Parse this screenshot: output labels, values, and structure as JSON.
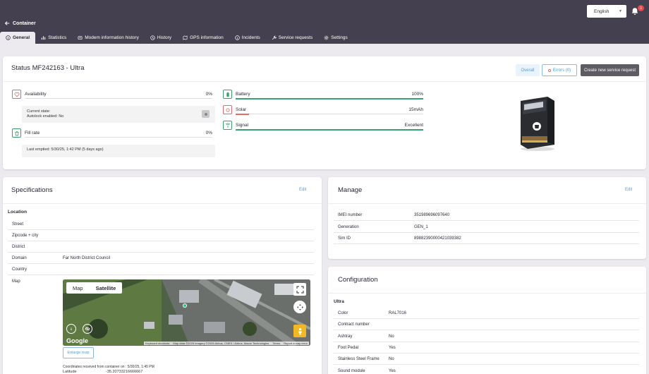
{
  "header": {
    "back_label": "Container",
    "language": "English",
    "notification_count": "0"
  },
  "tabs": [
    {
      "label": "General",
      "icon": "info-icon"
    },
    {
      "label": "Statistics",
      "icon": "bar-chart-icon"
    },
    {
      "label": "Modem information history",
      "icon": "modem-icon"
    },
    {
      "label": "History",
      "icon": "clock-icon"
    },
    {
      "label": "GPS information",
      "icon": "map-icon"
    },
    {
      "label": "Incidents",
      "icon": "info-icon"
    },
    {
      "label": "Service requests",
      "icon": "wrench-icon"
    },
    {
      "label": "Settings",
      "icon": "gear-icon"
    }
  ],
  "status": {
    "title": "Status MF242163 - Ultra",
    "overall_label": "Overall",
    "errors_label": "Errors (0)",
    "create_label": "Create new service request",
    "availability": {
      "label": "Availability",
      "value": "0%"
    },
    "current_state_label": "Current state:",
    "autolock_text": "Autolock enabled: No",
    "fill_rate": {
      "label": "Fill rate",
      "value": "0%"
    },
    "last_emptied": "Last emptied: 5/30/25, 1:42 PM (5 days ago)",
    "battery": {
      "label": "Battery",
      "value": "100%",
      "level": 1.0
    },
    "solar": {
      "label": "Solar",
      "value": "15mAh",
      "level": 0.07
    },
    "signal": {
      "label": "Signal",
      "value": "Excellent",
      "level": 1.0
    }
  },
  "specifications": {
    "title": "Specifications",
    "edit_label": "Edit",
    "location_label": "Location",
    "rows": [
      {
        "key": "Street",
        "value": ""
      },
      {
        "key": "Zipcode + city",
        "value": ""
      },
      {
        "key": "District",
        "value": ""
      },
      {
        "key": "Domain",
        "value": "Far North District Council"
      },
      {
        "key": "Country",
        "value": ""
      }
    ],
    "map_label": "Map",
    "map": {
      "map_tab": "Map",
      "satellite_tab": "Satellite",
      "google": "Google",
      "shortcuts": "Keyboard shortcuts",
      "data": "Map data ©2025 Imagery ©2025 Airbus, CNES / Airbus, Maxar Technologies",
      "terms": "Terms",
      "report": "Report a map error"
    },
    "enlarge_label": "Enlarge map",
    "coords_received": "Coordinates received from container on : 5/30/25, 1:45 PM",
    "latitude_label": "Latitude",
    "latitude_value": "-35.20733216666667"
  },
  "manage": {
    "title": "Manage",
    "edit_label": "Edit",
    "rows": [
      {
        "key": "IMEI number",
        "value": "351989696097640"
      },
      {
        "key": "Generation",
        "value": "GEN_1"
      },
      {
        "key": "Sim ID",
        "value": "89882390000421039382"
      }
    ]
  },
  "configuration": {
    "title": "Configuration",
    "section": "Ultra",
    "rows": [
      {
        "key": "Color",
        "value": "RAL7016"
      },
      {
        "key": "Contract number",
        "value": ""
      },
      {
        "key": "Ashtray",
        "value": "No"
      },
      {
        "key": "Foot Pedal",
        "value": "Yes"
      },
      {
        "key": "Stainless Steel Frame",
        "value": "No"
      },
      {
        "key": "Sound module",
        "value": "Yes"
      }
    ]
  },
  "colors": {
    "topbar": "#45404f",
    "accent": "#5b9ccf",
    "ok": "#3c9f6e",
    "alert": "#e06b6b"
  }
}
